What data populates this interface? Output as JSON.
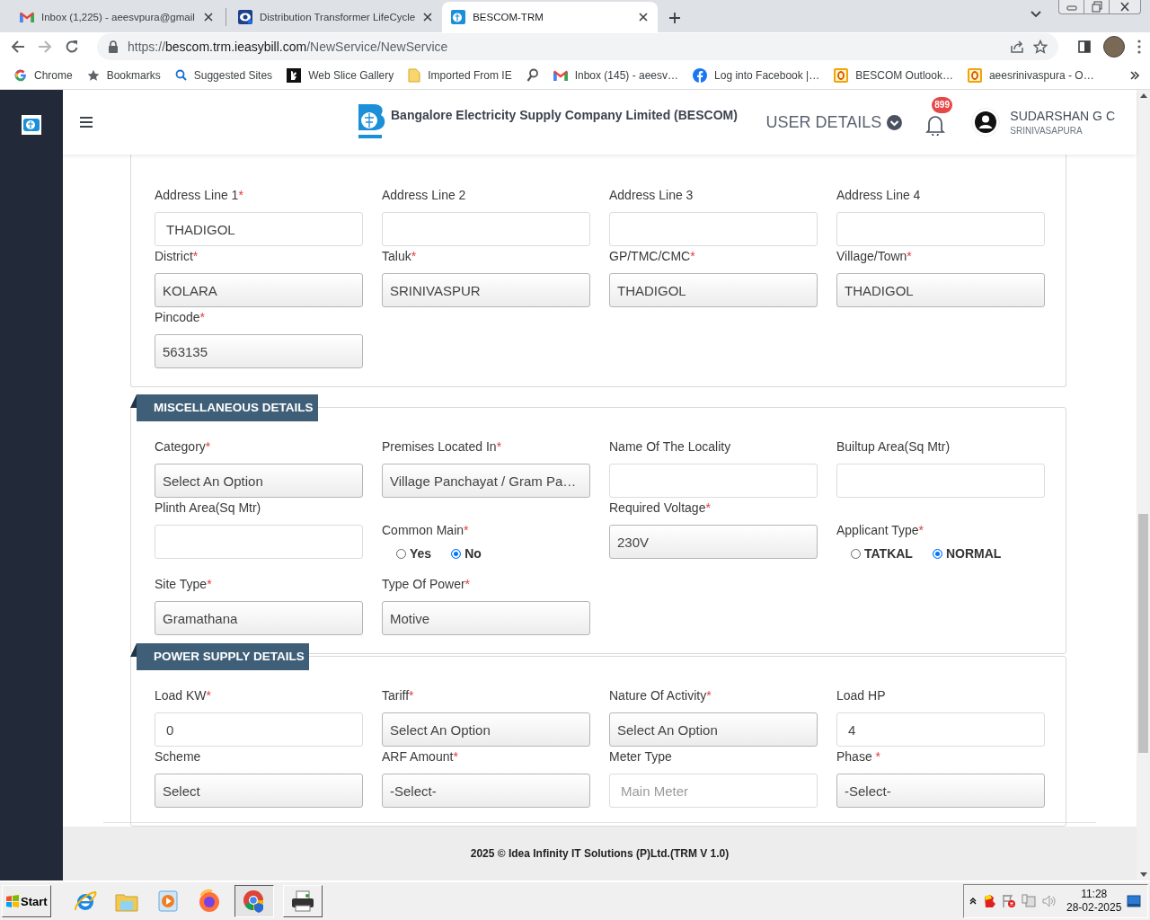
{
  "browser": {
    "tabs": [
      {
        "title": "Inbox (1,225) - aeesvpura@gmail",
        "selected": false
      },
      {
        "title": "Distribution Transformer LifeCycle",
        "selected": false
      },
      {
        "title": "BESCOM-TRM",
        "selected": true
      }
    ],
    "address": {
      "scheme": "https://",
      "host": "bescom.trm.ieasybill.com",
      "path": "/NewService/NewService"
    },
    "bookmarks": [
      {
        "kind": "link",
        "label": "Chrome"
      },
      {
        "kind": "link",
        "label": "Bookmarks"
      },
      {
        "kind": "link",
        "label": "Suggested Sites"
      },
      {
        "kind": "link",
        "label": "Web Slice Gallery"
      },
      {
        "kind": "link",
        "label": "Imported From IE"
      },
      {
        "kind": "icon"
      },
      {
        "kind": "link",
        "label": "Inbox (145) - aeesv…"
      },
      {
        "kind": "link",
        "label": "Log into Facebook |…"
      },
      {
        "kind": "link",
        "label": "BESCOM Outlook…"
      },
      {
        "kind": "link",
        "label": "aeesrinivaspura - O…"
      }
    ]
  },
  "page": {
    "header": {
      "title": "Bangalore Electricity Supply Company Limited (BESCOM)",
      "user_menu": "USER DETAILS",
      "notifications": "899",
      "user_name": "SUDARSHAN G C",
      "user_location": "SRINIVASAPURA"
    },
    "sections": [
      {
        "fields": [
          {
            "kind": "input",
            "label": "Address Line 1",
            "mark": "*",
            "value": "THADIGOL"
          },
          {
            "kind": "input",
            "label": "Address Line 2"
          },
          {
            "kind": "input",
            "label": "Address Line 3"
          },
          {
            "kind": "input",
            "label": "Address Line 4"
          },
          {
            "kind": "select",
            "label": "District",
            "mark": "*",
            "value": "KOLARA"
          },
          {
            "kind": "select",
            "label": "Taluk",
            "mark": "*",
            "value": "SRINIVASPUR"
          },
          {
            "kind": "select",
            "label": "GP/TMC/CMC",
            "mark": "*",
            "value": "THADIGOL"
          },
          {
            "kind": "select",
            "label": "Village/Town",
            "mark": "*",
            "value": "THADIGOL"
          },
          {
            "kind": "select",
            "label": "Pincode",
            "mark": "*",
            "value": "563135"
          }
        ]
      },
      {
        "title": "MISCELLANEOUS DETAILS",
        "fields": [
          {
            "kind": "select",
            "label": "Category",
            "mark": "*",
            "value": "Select An Option"
          },
          {
            "kind": "select",
            "label": "Premises Located In",
            "mark": "*",
            "value": "Village Panchayat / Gram Pa…"
          },
          {
            "kind": "input",
            "label": "Name Of The Locality"
          },
          {
            "kind": "input",
            "label": "Builtup Area(Sq Mtr)"
          },
          {
            "kind": "input",
            "label": "Plinth Area(Sq Mtr)"
          },
          {
            "kind": "radio",
            "label": "Common Main",
            "mark": "*",
            "options": [
              {
                "label": "Yes",
                "selected": false
              },
              {
                "label": "No",
                "selected": true
              }
            ]
          },
          {
            "kind": "select",
            "label": "Required Voltage",
            "mark": "*",
            "value": "230V"
          },
          {
            "kind": "radio",
            "label": "Applicant Type",
            "mark": "*",
            "options": [
              {
                "label": "TATKAL",
                "selected": false
              },
              {
                "label": "NORMAL",
                "selected": true
              }
            ]
          },
          {
            "kind": "select",
            "label": "Site Type",
            "mark": "*",
            "value": "Gramathana"
          },
          {
            "kind": "select",
            "label": "Type Of Power",
            "mark": "*",
            "value": "Motive"
          }
        ]
      },
      {
        "title": "POWER SUPPLY DETAILS",
        "fields": [
          {
            "kind": "input",
            "label": "Load KW",
            "mark": "*",
            "value": "0"
          },
          {
            "kind": "select",
            "label": "Tariff",
            "mark": "*",
            "value": "Select An Option"
          },
          {
            "kind": "select",
            "label": "Nature Of Activity",
            "mark": "*",
            "value": "Select An Option"
          },
          {
            "kind": "input",
            "label": "Load HP",
            "value": "4"
          },
          {
            "kind": "select",
            "label": "Scheme",
            "value": "Select"
          },
          {
            "kind": "select",
            "label": "ARF Amount",
            "mark": "*",
            "value": "-Select-"
          },
          {
            "kind": "input",
            "label": "Meter Type",
            "placeholder": "Main Meter"
          },
          {
            "kind": "select",
            "label": "Phase",
            "mark": " *",
            "value": "-Select-"
          }
        ]
      }
    ],
    "footer": "2025 © Idea Infinity IT Solutions (P)Ltd.(TRM V 1.0)"
  },
  "taskbar": {
    "start": "Start",
    "apps": [
      {
        "kind": "launcher"
      },
      {
        "kind": "launcher"
      },
      {
        "kind": "launcher"
      },
      {
        "kind": "launcher"
      },
      {
        "kind": "task",
        "selected": true
      },
      {
        "kind": "task",
        "selected": false
      }
    ],
    "clock": {
      "time": "11:28",
      "date": "28-02-2025"
    }
  }
}
